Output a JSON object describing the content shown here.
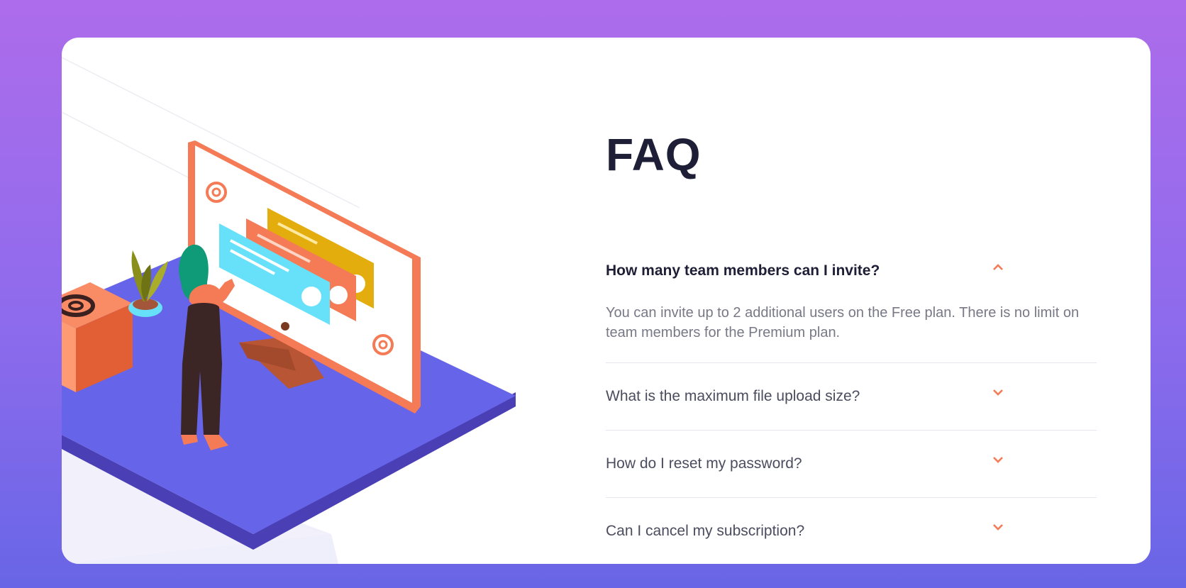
{
  "faq": {
    "title": "FAQ",
    "items": [
      {
        "question": "How many team members can I invite?",
        "answer": "You can invite up to 2 additional users on the Free plan. There is no limit on team members for the Premium plan.",
        "open": true
      },
      {
        "question": "What is the maximum file upload size?",
        "open": false
      },
      {
        "question": "How do I reset my password?",
        "open": false
      },
      {
        "question": "Can I cancel my subscription?",
        "open": false
      }
    ]
  },
  "colors": {
    "accent": "#f47b56",
    "heading": "#1e1f36",
    "text": "#4b4c5f",
    "bg_top": "#ad6ceb",
    "bg_bottom": "#6866e6"
  },
  "icons": {
    "open": "chevron-up-icon",
    "closed": "chevron-down-icon",
    "at_symbol": "at-sign-icon"
  }
}
